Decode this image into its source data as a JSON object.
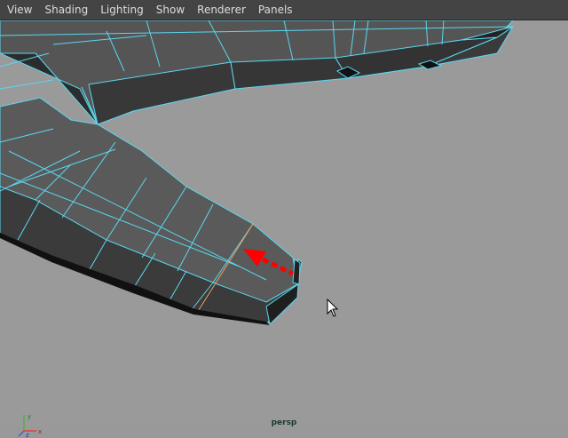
{
  "menubar": {
    "items": [
      "View",
      "Shading",
      "Lighting",
      "Show",
      "Renderer",
      "Panels"
    ]
  },
  "viewport": {
    "camera": "persp"
  },
  "colors": {
    "background": "#9a9a9a",
    "menubar": "#444444",
    "wireframe": "#5ad7f0",
    "selected_edge": "#e8a05a",
    "arrow": "#ff0000"
  },
  "icons": {
    "axis": "xyz-axis-indicator-icon",
    "cursor": "mouse-pointer-icon"
  }
}
